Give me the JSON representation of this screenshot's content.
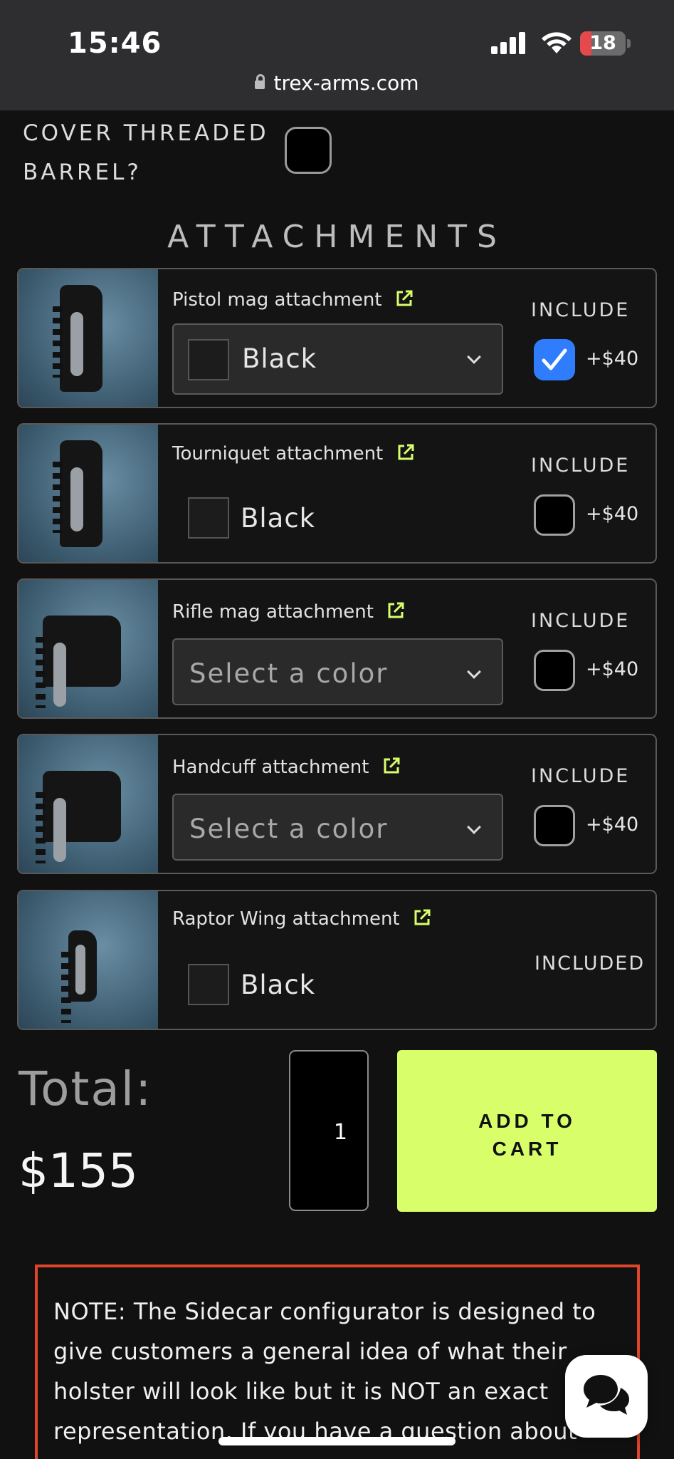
{
  "status_bar": {
    "time": "15:46",
    "battery": "18",
    "url": "trex-arms.com"
  },
  "threaded_barrel": {
    "label_line1": "COVER THREADED",
    "label_line2": "BARREL?",
    "checked": false
  },
  "attachments": {
    "heading": "ATTACHMENTS",
    "items": [
      {
        "title": "Pistol mag attachment",
        "color_label": "Black",
        "control": "select",
        "include_label": "INCLUDE",
        "included": true,
        "price": "+$40"
      },
      {
        "title": "Tourniquet attachment",
        "color_label": "Black",
        "control": "static",
        "include_label": "INCLUDE",
        "included": false,
        "price": "+$40"
      },
      {
        "title": "Rifle mag attachment",
        "color_label": "Select a color",
        "control": "select",
        "include_label": "INCLUDE",
        "included": false,
        "price": "+$40"
      },
      {
        "title": "Handcuff attachment",
        "color_label": "Select a color",
        "control": "select",
        "include_label": "INCLUDE",
        "included": false,
        "price": "+$40"
      },
      {
        "title": "Raptor Wing attachment",
        "color_label": "Black",
        "control": "static",
        "included_label": "INCLUDED"
      }
    ]
  },
  "cart": {
    "total_label": "Total:",
    "total_value": "$155",
    "quantity": "1",
    "add_to_cart_line1": "ADD TO",
    "add_to_cart_line2": "CART"
  },
  "note": {
    "text": "NOTE: The Sidecar configurator is designed to give customers a general idea of what their holster will look like but it is NOT an exact representation. If you have a question about holster specs (e.g. number of Spine teeth)"
  },
  "colors": {
    "accent_cta": "#d8ff6a",
    "checkbox_checked": "#2f7dfc",
    "note_border": "#e0452b",
    "link_icon": "#d8ff6a"
  }
}
